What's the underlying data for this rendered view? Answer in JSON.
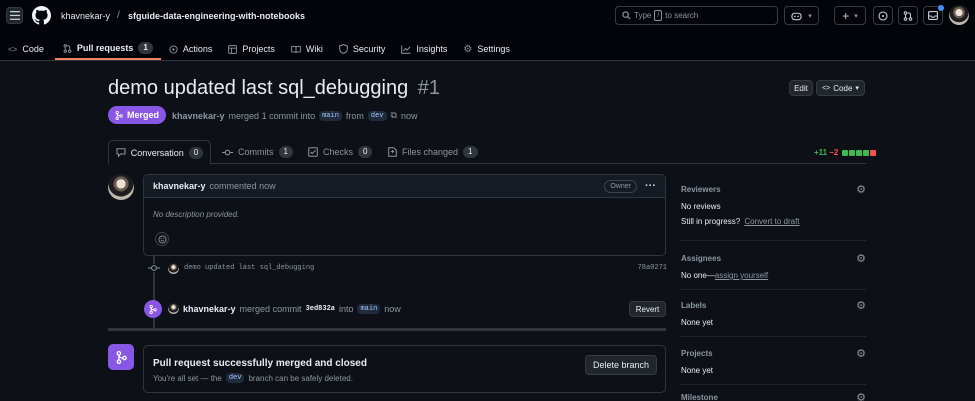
{
  "header": {
    "owner": "khavnekar-y",
    "separator": "/",
    "repo": "sfguide-data-engineering-with-notebooks",
    "search_prefix": "Type",
    "search_key": "/",
    "search_suffix": "to search",
    "plus": "+"
  },
  "tabs": [
    {
      "label": "Code",
      "icon": "code-icon"
    },
    {
      "label": "Pull requests",
      "count": "1",
      "icon": "pull-request-icon"
    },
    {
      "label": "Actions",
      "icon": "play-icon"
    },
    {
      "label": "Projects",
      "icon": "table-icon"
    },
    {
      "label": "Wiki",
      "icon": "book-icon"
    },
    {
      "label": "Security",
      "icon": "shield-icon"
    },
    {
      "label": "Insights",
      "icon": "graph-icon"
    },
    {
      "label": "Settings",
      "icon": "gear-icon"
    }
  ],
  "pr": {
    "title": "demo updated last sql_debugging",
    "number": "#1",
    "edit_label": "Edit",
    "code_label": "Code",
    "status": "Merged",
    "author": "khavnekar-y",
    "merge_text": "merged 1 commit into",
    "base": "main",
    "from_text": "from",
    "head": "dev",
    "time": "now"
  },
  "pr_tabs": [
    {
      "label": "Conversation",
      "count": "0",
      "icon": "comment-icon"
    },
    {
      "label": "Commits",
      "count": "1",
      "icon": "commit-icon"
    },
    {
      "label": "Checks",
      "count": "0",
      "icon": "checklist-icon"
    },
    {
      "label": "Files changed",
      "count": "1",
      "icon": "file-diff-icon"
    }
  ],
  "diffstat": {
    "added": "+11",
    "removed": "−2",
    "added_blocks": 4,
    "removed_blocks": 1
  },
  "comment": {
    "author": "khavnekar-y",
    "action": "commented now",
    "badge": "Owner",
    "more": "···",
    "body": "No description provided."
  },
  "commit": {
    "message": "demo updated last sql_debugging",
    "sha": "78a0271"
  },
  "merge_event": {
    "author": "khavnekar-y",
    "text": "merged commit",
    "sha": "3ed832a",
    "into": "into",
    "branch": "main",
    "time": "now",
    "revert_label": "Revert"
  },
  "merged_box": {
    "title": "Pull request successfully merged and closed",
    "line_prefix": "You're all set — the",
    "branch": "dev",
    "line_suffix": "branch can be safely deleted.",
    "delete_label": "Delete branch"
  },
  "sidebar": {
    "reviewers_title": "Reviewers",
    "reviewers_value": "No reviews",
    "in_progress": "Still in progress?",
    "convert": "Convert to draft",
    "assignees_title": "Assignees",
    "assignees_value": "No one—",
    "assign_self": "assign yourself",
    "labels_title": "Labels",
    "labels_value": "None yet",
    "projects_title": "Projects",
    "projects_value": "None yet",
    "milestone_title": "Milestone"
  },
  "colors": {
    "merged": "#8957e5",
    "added": "#3fb950",
    "removed": "#f85149",
    "accent_tab": "#f78166",
    "background": "#0d1117",
    "header": "#010409"
  }
}
